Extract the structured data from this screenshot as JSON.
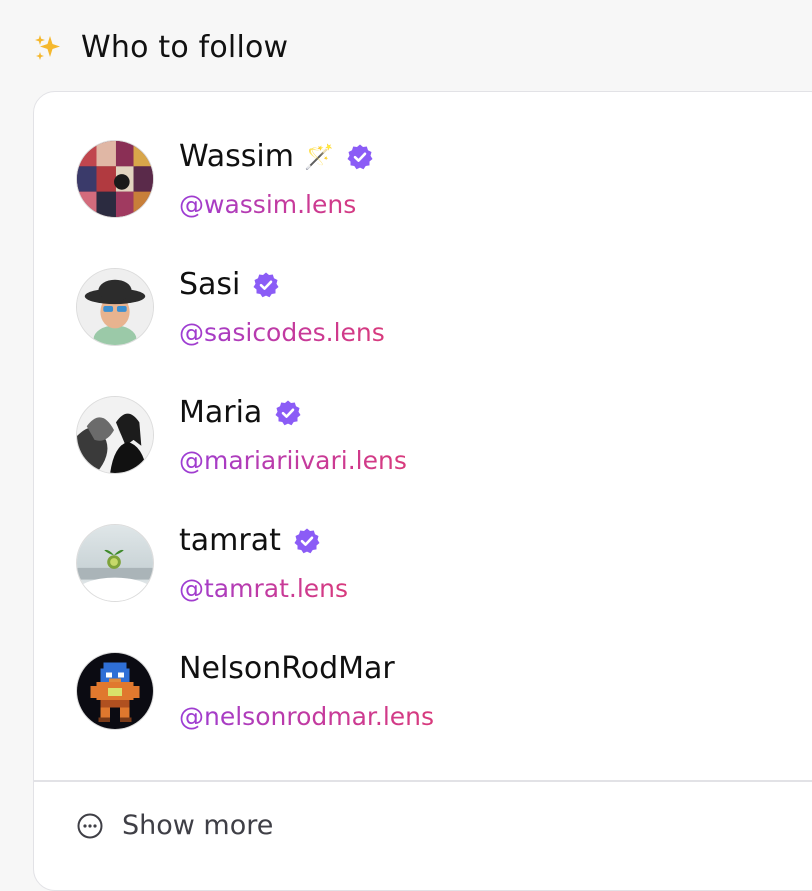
{
  "header": {
    "title": "Who to follow",
    "icon": "sparkles-icon"
  },
  "users": [
    {
      "name": "Wassim",
      "emoji": "🪄",
      "handle": "@wassim.lens",
      "verified": true
    },
    {
      "name": "Sasi",
      "emoji": "",
      "handle": "@sasicodes.lens",
      "verified": true
    },
    {
      "name": "Maria",
      "emoji": "",
      "handle": "@mariariivari.lens",
      "verified": true
    },
    {
      "name": "tamrat",
      "emoji": "",
      "handle": "@tamrat.lens",
      "verified": true
    },
    {
      "name": "NelsonRodMar",
      "emoji": "",
      "handle": "@nelsonrodmar.lens",
      "verified": false
    }
  ],
  "footer": {
    "show_more_label": "Show more",
    "icon": "more-dots-icon"
  },
  "colors": {
    "verified_badge": "#8b5cf6",
    "handle_gradient_start": "#9b3dd6",
    "handle_gradient_end": "#d83a7c",
    "sparkle": "#f5b82e"
  }
}
